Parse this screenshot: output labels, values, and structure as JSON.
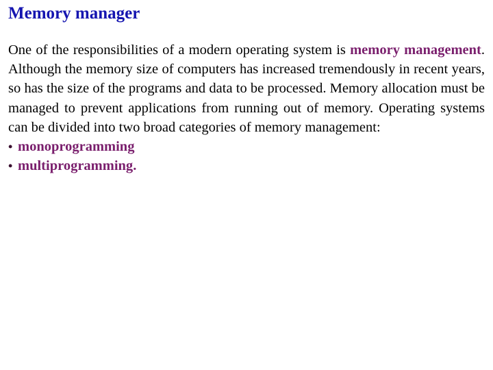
{
  "slide": {
    "title": "Memory manager",
    "title_color": "#1515b0",
    "background_color": "#ffffff",
    "body_color": "#000000",
    "highlight_color": "#7a1f6d",
    "paragraph": {
      "segment_1": "One of the responsibilities of a modern operating system is ",
      "highlight_1": "memory management",
      "segment_2": ". Although the memory size of computers has increased tremendously in recent years, so has the size of the programs and data to be processed. Memory allocation must be managed to prevent applications from running out of memory. Operating systems can be divided into two broad categories of memory management:"
    },
    "bullets": [
      {
        "marker": "•",
        "label": "monoprogramming",
        "tail": ""
      },
      {
        "marker": "•",
        "label": "multiprogramming",
        "tail": "."
      }
    ]
  }
}
